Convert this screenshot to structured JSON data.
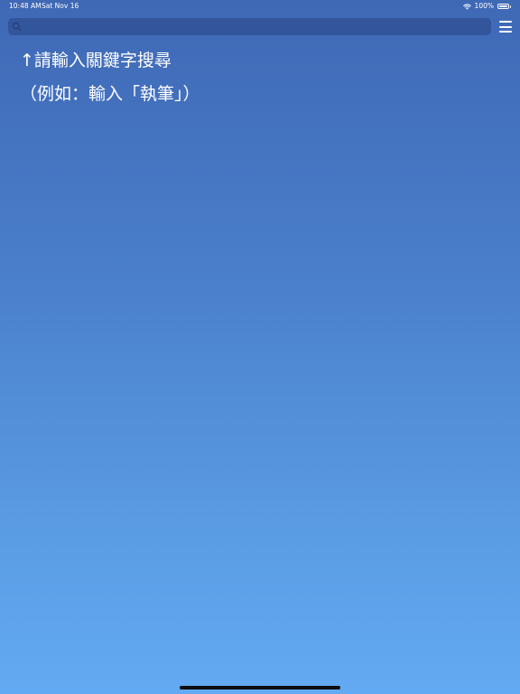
{
  "status_bar": {
    "time": "10:48 AM",
    "date": "Sat Nov 16",
    "battery_text": "100%",
    "icons": [
      "wifi-icon",
      "battery-icon"
    ]
  },
  "search": {
    "placeholder": "",
    "value": "",
    "icon": "search-icon"
  },
  "menu": {
    "icon": "hamburger-menu-icon"
  },
  "hint": {
    "line1": "↑請輸入關鍵字搜尋",
    "line2": "（例如：輸入「執筆」）"
  },
  "colors": {
    "background_top": "#3f68b5",
    "background_bottom": "#62aaf3",
    "text": "#ffffff"
  }
}
